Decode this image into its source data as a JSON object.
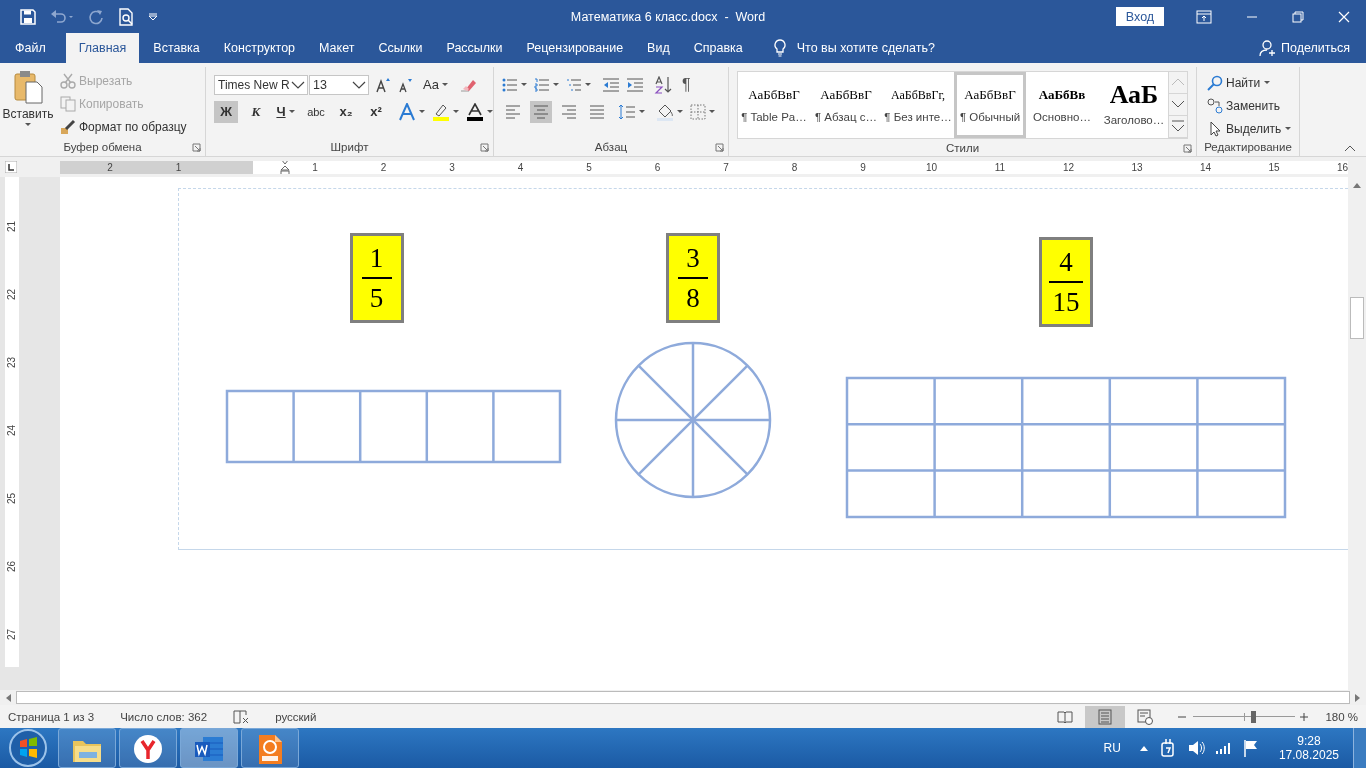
{
  "title_bar": {
    "document_title": "Математика 6 класс.docx  -  Word",
    "sign_in": "Вход"
  },
  "ribbon_tabs": [
    {
      "label": "Файл",
      "selected": false
    },
    {
      "label": "Главная",
      "selected": true
    },
    {
      "label": "Вставка",
      "selected": false
    },
    {
      "label": "Конструктор",
      "selected": false
    },
    {
      "label": "Макет",
      "selected": false
    },
    {
      "label": "Ссылки",
      "selected": false
    },
    {
      "label": "Рассылки",
      "selected": false
    },
    {
      "label": "Рецензирование",
      "selected": false
    },
    {
      "label": "Вид",
      "selected": false
    },
    {
      "label": "Справка",
      "selected": false
    }
  ],
  "tell_me": "Что вы хотите сделать?",
  "share": "Поделиться",
  "clipboard": {
    "paste": "Вставить",
    "cut": {
      "label": "Вырезать",
      "disabled": true
    },
    "copy": {
      "label": "Копировать",
      "disabled": true
    },
    "format_painter": {
      "label": "Формат по образцу",
      "disabled": false
    },
    "group_label": "Буфер обмена"
  },
  "font": {
    "name": "Times New R",
    "size": "13",
    "change_case": "Aa",
    "group_label": "Шрифт",
    "format_buttons": [
      {
        "kind": "bold",
        "label": "Ж",
        "selected": true
      },
      {
        "kind": "italic",
        "label": "К",
        "selected": false
      },
      {
        "kind": "underline",
        "label": "Ч",
        "selected": false
      },
      {
        "kind": "strike",
        "label": "abc",
        "selected": false
      },
      {
        "kind": "sub",
        "label": "x₂",
        "selected": false
      },
      {
        "kind": "sup",
        "label": "x²",
        "selected": false
      }
    ]
  },
  "paragraph": {
    "show_marks": "¶",
    "group_label": "Абзац",
    "align_buttons": [
      {
        "kind": "left",
        "selected": false
      },
      {
        "kind": "center",
        "selected": true
      },
      {
        "kind": "right",
        "selected": false
      },
      {
        "kind": "justify",
        "selected": false
      }
    ]
  },
  "styles": {
    "group_label": "Стили",
    "items": [
      {
        "sample": "АаБбВвГ",
        "name": "¶ Table Pa…",
        "kind": "normal",
        "selected": false
      },
      {
        "sample": "АаБбВвГ",
        "name": "¶ Абзац с…",
        "kind": "normal",
        "selected": false
      },
      {
        "sample": "АаБбВвГг,",
        "name": "¶ Без инте…",
        "kind": "small",
        "selected": false
      },
      {
        "sample": "АаБбВвГ",
        "name": "¶ Обычный",
        "kind": "normal",
        "selected": true
      },
      {
        "sample": "АаБбВв",
        "name": "Основно…",
        "kind": "bold",
        "selected": false
      },
      {
        "sample": "АаБ",
        "name": "Заголово…",
        "kind": "heading",
        "selected": false
      }
    ]
  },
  "editing": {
    "find": "Найти",
    "replace": "Заменить",
    "select": "Выделить",
    "group_label": "Редактирование"
  },
  "ruler": {
    "left_marks": [
      "2",
      "1"
    ],
    "right_marks": [
      "1",
      "2",
      "3",
      "4",
      "5",
      "6",
      "7",
      "8",
      "9",
      "10",
      "11",
      "12",
      "13",
      "14",
      "15",
      "16"
    ]
  },
  "vertical_ruler": [
    "21",
    "22",
    "23",
    "24",
    "25",
    "26",
    "27"
  ],
  "figures": [
    {
      "numerator": "1",
      "denominator": "5",
      "kind": "strip"
    },
    {
      "numerator": "3",
      "denominator": "8",
      "kind": "circle"
    },
    {
      "numerator": "4",
      "denominator": "15",
      "kind": "grid"
    }
  ],
  "status_bar": {
    "page": "Страница 1 из 3",
    "words": "Число слов: 362",
    "language": "русский",
    "zoom": "180 %",
    "zoom_slider": {
      "level": 0.58
    },
    "views": [
      {
        "kind": "read",
        "selected": false
      },
      {
        "kind": "print",
        "selected": true
      },
      {
        "kind": "web",
        "selected": false
      }
    ]
  },
  "taskbar": {
    "apps": [
      {
        "kind": "folder",
        "selected": false
      },
      {
        "kind": "browser",
        "selected": false
      },
      {
        "kind": "word",
        "selected": true
      },
      {
        "kind": "pdf",
        "selected": false
      }
    ],
    "language": "RU",
    "time": "9:28",
    "date": "17.08.2025"
  }
}
